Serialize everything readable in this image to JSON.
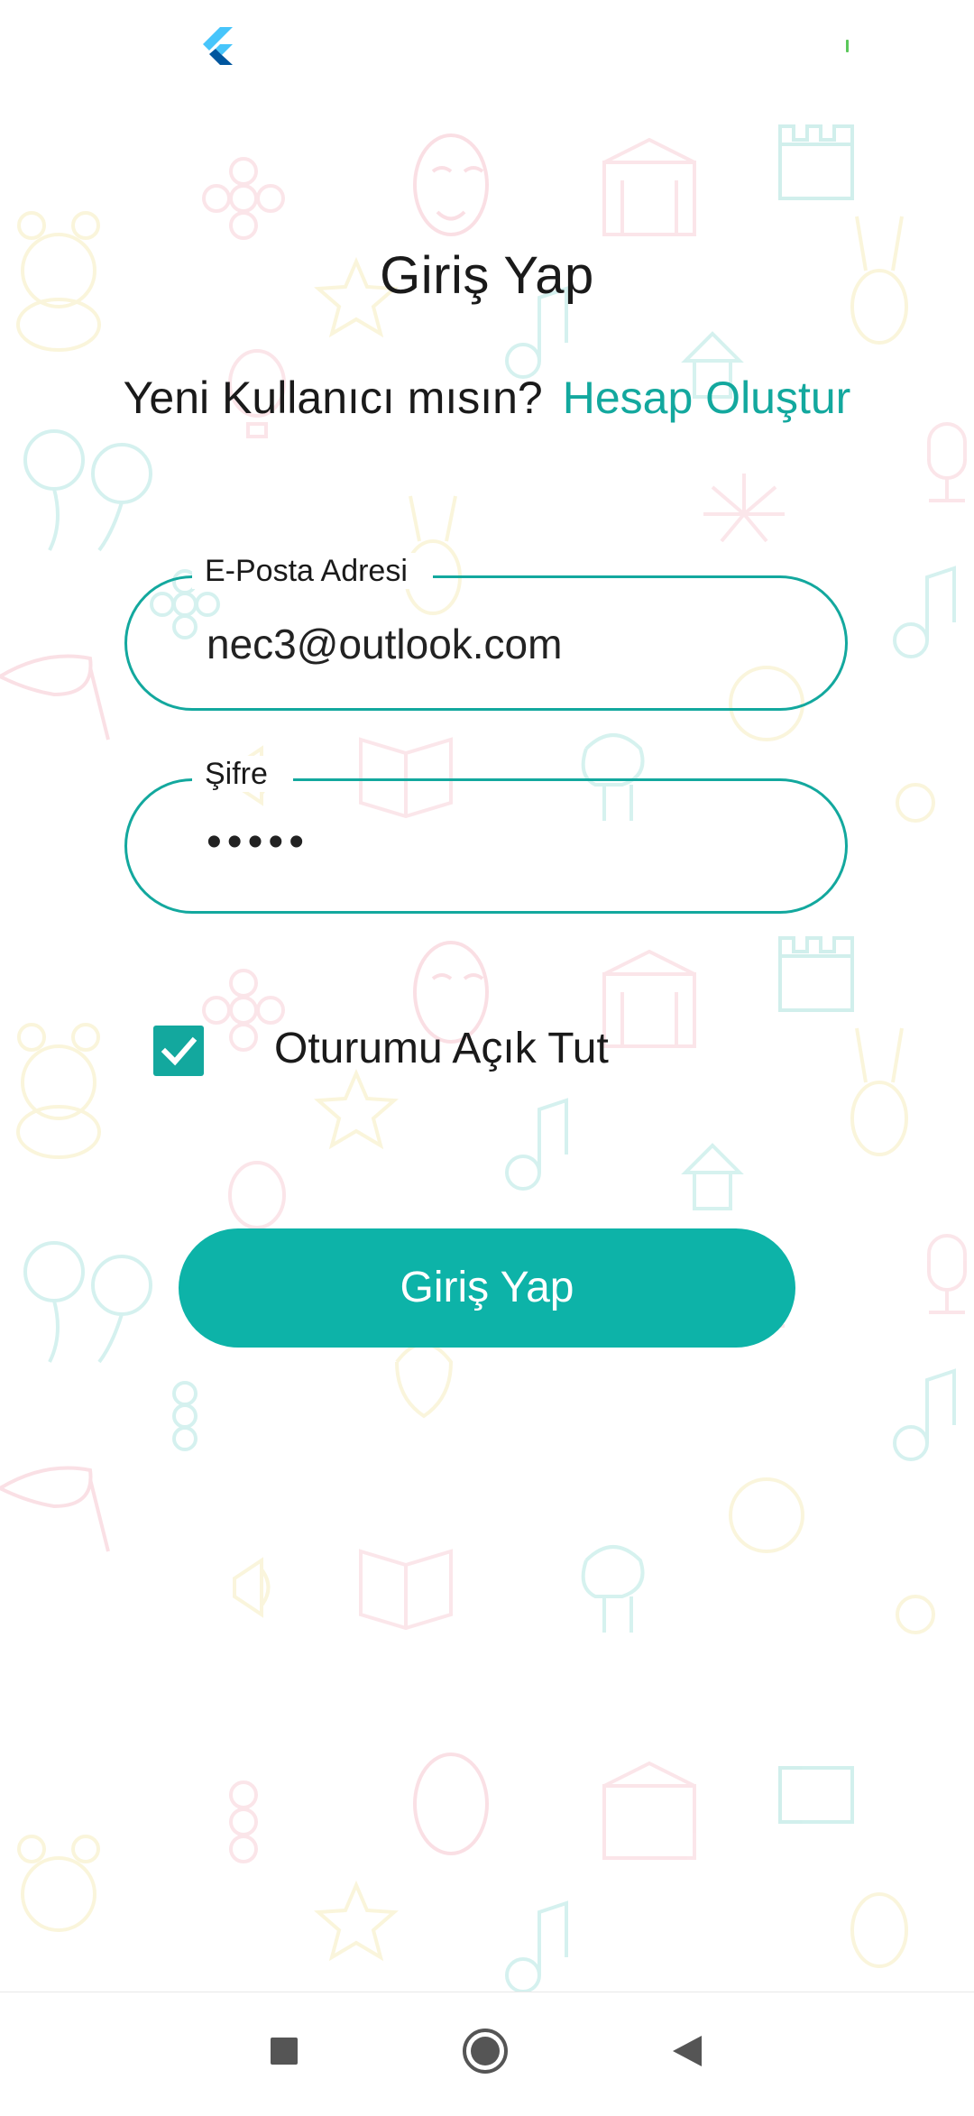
{
  "status_bar": {
    "app_icon": "flutter-logo-icon"
  },
  "login": {
    "title": "Giriş Yap",
    "new_user_question": "Yeni Kullanıcı mısın?",
    "create_account_link": "Hesap Oluştur",
    "email": {
      "label": "E-Posta Adresi",
      "value": "nec3@outlook.com"
    },
    "password": {
      "label": "Şifre",
      "value": "•••••"
    },
    "remember_me": {
      "label": "Oturumu Açık Tut",
      "checked": true
    },
    "submit_label": "Giriş Yap"
  },
  "nav_bar": {
    "recents_icon": "square-icon",
    "home_icon": "circle-home-icon",
    "back_icon": "triangle-back-icon"
  },
  "colors": {
    "accent": "#13a89e",
    "button": "#0db3a8",
    "text": "#1a1a1a",
    "background": "#ffffff"
  }
}
